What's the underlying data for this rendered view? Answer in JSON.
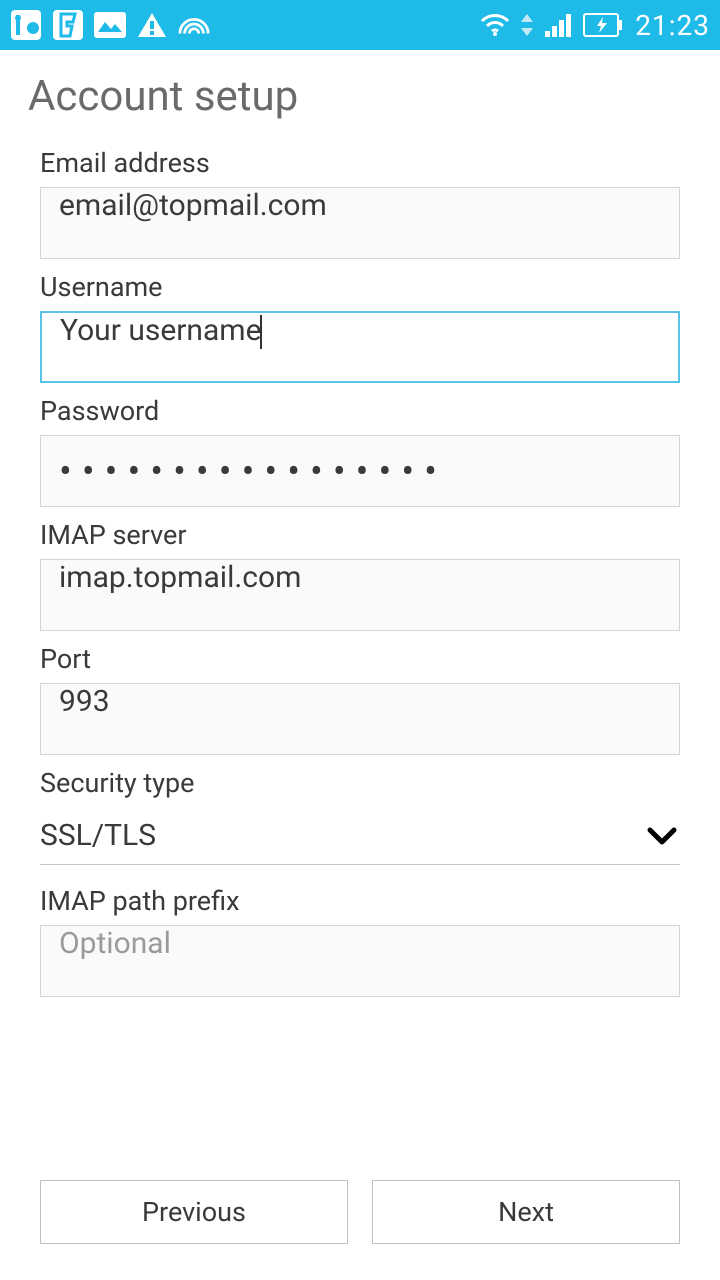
{
  "status": {
    "time": "21:23"
  },
  "title": "Account setup",
  "fields": {
    "email": {
      "label": "Email address",
      "value": "email@topmail.com"
    },
    "username": {
      "label": "Username",
      "value": "Your username"
    },
    "password": {
      "label": "Password",
      "value": "•••••••••••••••••"
    },
    "imap_server": {
      "label": "IMAP server",
      "value": "imap.topmail.com"
    },
    "port": {
      "label": "Port",
      "value": "993"
    },
    "security": {
      "label": "Security type",
      "value": "SSL/TLS"
    },
    "path_prefix": {
      "label": "IMAP path prefix",
      "placeholder": "Optional",
      "value": ""
    }
  },
  "buttons": {
    "previous": "Previous",
    "next": "Next"
  }
}
